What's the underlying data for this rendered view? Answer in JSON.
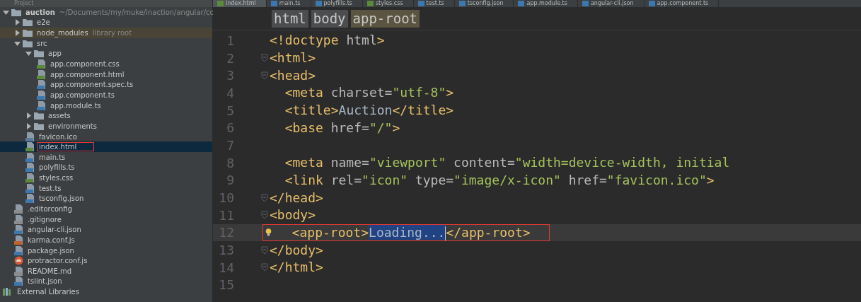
{
  "project_panel": {
    "title": "Project",
    "tree": [
      {
        "name": "auction",
        "note": "~/Documents/my/muke/inaction/angular/co",
        "kind": "folder",
        "expanded": true,
        "selected": false,
        "library_root": false,
        "highlighted": false,
        "children": [
          {
            "name": "e2e",
            "kind": "folder",
            "expanded": false,
            "selected": false,
            "library_root": false,
            "highlighted": false
          },
          {
            "name": "node_modules",
            "note": "library root",
            "kind": "folder",
            "expanded": false,
            "selected": false,
            "library_root": true,
            "highlighted": false
          },
          {
            "name": "src",
            "kind": "folder",
            "expanded": true,
            "selected": false,
            "library_root": false,
            "highlighted": false,
            "children": [
              {
                "name": "app",
                "kind": "folder",
                "expanded": true,
                "selected": false,
                "library_root": false,
                "highlighted": false,
                "children": [
                  {
                    "name": "app.component.css",
                    "kind": "css",
                    "selected": false,
                    "library_root": false,
                    "highlighted": false
                  },
                  {
                    "name": "app.component.html",
                    "kind": "html",
                    "selected": false,
                    "library_root": false,
                    "highlighted": false
                  },
                  {
                    "name": "app.component.spec.ts",
                    "kind": "ts",
                    "selected": false,
                    "library_root": false,
                    "highlighted": false
                  },
                  {
                    "name": "app.component.ts",
                    "kind": "ts",
                    "selected": false,
                    "library_root": false,
                    "highlighted": false
                  },
                  {
                    "name": "app.module.ts",
                    "kind": "ts",
                    "selected": false,
                    "library_root": false,
                    "highlighted": false
                  }
                ]
              },
              {
                "name": "assets",
                "kind": "folder",
                "expanded": false,
                "selected": false,
                "library_root": false,
                "highlighted": false
              },
              {
                "name": "environments",
                "kind": "folder",
                "expanded": false,
                "selected": false,
                "library_root": false,
                "highlighted": false
              },
              {
                "name": "favicon.ico",
                "kind": "image",
                "selected": false,
                "library_root": false,
                "highlighted": false
              },
              {
                "name": "index.html",
                "kind": "html",
                "selected": true,
                "library_root": false,
                "highlighted": true
              },
              {
                "name": "main.ts",
                "kind": "ts",
                "selected": false,
                "library_root": false,
                "highlighted": false
              },
              {
                "name": "polyfills.ts",
                "kind": "ts",
                "selected": false,
                "library_root": false,
                "highlighted": false
              },
              {
                "name": "styles.css",
                "kind": "css",
                "selected": false,
                "library_root": false,
                "highlighted": false
              },
              {
                "name": "test.ts",
                "kind": "ts",
                "selected": false,
                "library_root": false,
                "highlighted": false
              },
              {
                "name": "tsconfig.json",
                "kind": "json",
                "selected": false,
                "library_root": false,
                "highlighted": false
              }
            ]
          },
          {
            "name": ".editorconfig",
            "kind": "text",
            "selected": false,
            "library_root": false,
            "highlighted": false
          },
          {
            "name": ".gitignore",
            "kind": "text",
            "selected": false,
            "library_root": false,
            "highlighted": false
          },
          {
            "name": "angular-cli.json",
            "kind": "json",
            "selected": false,
            "library_root": false,
            "highlighted": false
          },
          {
            "name": "karma.conf.js",
            "kind": "js",
            "selected": false,
            "library_root": false,
            "highlighted": false
          },
          {
            "name": "package.json",
            "kind": "json",
            "selected": false,
            "library_root": false,
            "highlighted": false
          },
          {
            "name": "protractor.conf.js",
            "kind": "protractor",
            "selected": false,
            "library_root": false,
            "highlighted": false
          },
          {
            "name": "README.md",
            "kind": "text",
            "selected": false,
            "library_root": false,
            "highlighted": false
          },
          {
            "name": "tslint.json",
            "kind": "json",
            "selected": false,
            "library_root": false,
            "highlighted": false
          }
        ]
      },
      {
        "name": "External Libraries",
        "kind": "libraries",
        "selected": false,
        "library_root": false,
        "highlighted": false
      }
    ]
  },
  "tabs": [
    {
      "label": "index.html",
      "kind": "html",
      "selected": true
    },
    {
      "label": "main.ts",
      "kind": "ts",
      "selected": false
    },
    {
      "label": "polyfills.ts",
      "kind": "ts",
      "selected": false
    },
    {
      "label": "styles.css",
      "kind": "css",
      "selected": false
    },
    {
      "label": "test.ts",
      "kind": "ts",
      "selected": false
    },
    {
      "label": "tsconfig.json",
      "kind": "json",
      "selected": false
    },
    {
      "label": "app.module.ts",
      "kind": "ts",
      "selected": false
    },
    {
      "label": "angular-cli.json",
      "kind": "json",
      "selected": false
    },
    {
      "label": "app.component.ts",
      "kind": "ts",
      "selected": false
    }
  ],
  "breadcrumb": [
    {
      "label": "html",
      "selected": false
    },
    {
      "label": "body",
      "selected": false
    },
    {
      "label": "app-root",
      "selected": true
    }
  ],
  "code_lines": [
    {
      "number": "1",
      "fold": false,
      "current": false,
      "highlighted": false,
      "bulb": false,
      "segments": [
        {
          "kind": "tag",
          "text": "<!doctype"
        },
        {
          "kind": "attr",
          "text": " html"
        },
        {
          "kind": "tag",
          "text": ">"
        }
      ]
    },
    {
      "number": "2",
      "fold": true,
      "current": false,
      "highlighted": false,
      "bulb": false,
      "segments": [
        {
          "kind": "tag",
          "text": "<html>"
        }
      ]
    },
    {
      "number": "3",
      "fold": true,
      "current": false,
      "highlighted": false,
      "bulb": false,
      "segments": [
        {
          "kind": "tag",
          "text": "<head>"
        }
      ]
    },
    {
      "number": "4",
      "fold": false,
      "current": false,
      "highlighted": false,
      "bulb": false,
      "segments": [
        {
          "kind": "tag",
          "text": "  <meta"
        },
        {
          "kind": "attr",
          "text": " charset="
        },
        {
          "kind": "string",
          "text": "\"utf-8\""
        },
        {
          "kind": "tag",
          "text": ">"
        }
      ]
    },
    {
      "number": "5",
      "fold": false,
      "current": false,
      "highlighted": false,
      "bulb": false,
      "segments": [
        {
          "kind": "tag",
          "text": "  <title>"
        },
        {
          "kind": "text",
          "text": "Auction"
        },
        {
          "kind": "tag",
          "text": "</title>"
        }
      ]
    },
    {
      "number": "6",
      "fold": false,
      "current": false,
      "highlighted": false,
      "bulb": false,
      "segments": [
        {
          "kind": "tag",
          "text": "  <base"
        },
        {
          "kind": "attr",
          "text": " href="
        },
        {
          "kind": "string",
          "text": "\"/\""
        },
        {
          "kind": "tag",
          "text": ">"
        }
      ]
    },
    {
      "number": "7",
      "fold": false,
      "current": false,
      "highlighted": false,
      "bulb": false
    },
    {
      "number": "8",
      "fold": false,
      "current": false,
      "highlighted": false,
      "bulb": false,
      "segments": [
        {
          "kind": "tag",
          "text": "  <meta"
        },
        {
          "kind": "attr",
          "text": " name="
        },
        {
          "kind": "string",
          "text": "\"viewport\""
        },
        {
          "kind": "attr",
          "text": " content="
        },
        {
          "kind": "string",
          "text": "\"width=device-width, initial"
        }
      ]
    },
    {
      "number": "9",
      "fold": false,
      "current": false,
      "highlighted": false,
      "bulb": false,
      "segments": [
        {
          "kind": "tag",
          "text": "  <link"
        },
        {
          "kind": "attr",
          "text": " rel="
        },
        {
          "kind": "string",
          "text": "\"icon\""
        },
        {
          "kind": "attr",
          "text": " type="
        },
        {
          "kind": "string",
          "text": "\"image/x-icon\""
        },
        {
          "kind": "attr",
          "text": " href="
        },
        {
          "kind": "string",
          "text": "\"favicon.ico\""
        },
        {
          "kind": "tag",
          "text": ">"
        }
      ]
    },
    {
      "number": "10",
      "fold": true,
      "current": false,
      "highlighted": false,
      "bulb": false,
      "segments": [
        {
          "kind": "tag",
          "text": "</head>"
        }
      ]
    },
    {
      "number": "11",
      "fold": true,
      "current": false,
      "highlighted": false,
      "bulb": false,
      "segments": [
        {
          "kind": "tag",
          "text": "<body>"
        }
      ]
    },
    {
      "number": "12",
      "fold": false,
      "current": true,
      "highlighted": true,
      "bulb": true,
      "segments": [
        {
          "kind": "tag",
          "text": "  <app-root>"
        },
        {
          "kind": "selection",
          "text": "Loading..."
        },
        {
          "kind": "tag",
          "text": "</app-root>"
        }
      ]
    },
    {
      "number": "13",
      "fold": true,
      "current": false,
      "highlighted": false,
      "bulb": false,
      "segments": [
        {
          "kind": "tag",
          "text": "</body>"
        }
      ]
    },
    {
      "number": "14",
      "fold": true,
      "current": false,
      "highlighted": false,
      "bulb": false,
      "segments": [
        {
          "kind": "tag",
          "text": "</html>"
        }
      ]
    },
    {
      "number": "15",
      "fold": false,
      "current": false,
      "highlighted": false,
      "bulb": false
    }
  ]
}
